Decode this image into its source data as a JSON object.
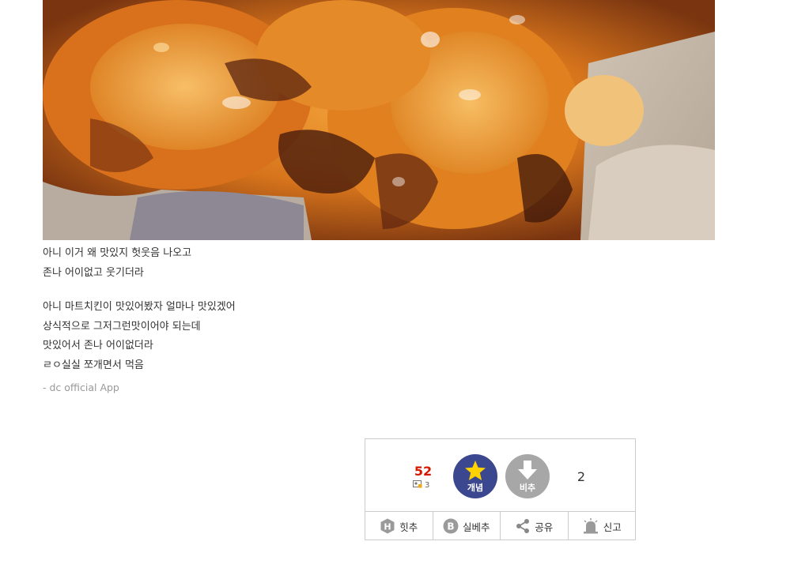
{
  "post": {
    "lines_1": [
      "아니 이거 왜 맛있지 헛웃음 나오고",
      "존나 어이없고 웃기더라"
    ],
    "lines_2": [
      "아니 마트치킨이 맛있어봤자 얼마나 맛있겠어",
      "상식적으로 그저그런맛이어야 되는데",
      "맛있어서 존나 어이없더라",
      "ㄹㅇ실실 쪼개면서 먹음"
    ],
    "signature": "- dc official App"
  },
  "vote": {
    "up_count": "52",
    "fixed_count": "3",
    "up_label": "개념",
    "down_label": "비추",
    "down_count": "2",
    "up_color": "#3b4890",
    "down_color": "#a7a7a7",
    "count_color": "#d31900",
    "star_color": "#ffd200"
  },
  "actions": [
    {
      "label": "힛추",
      "icon": "hit-icon"
    },
    {
      "label": "실베추",
      "icon": "best-icon"
    },
    {
      "label": "공유",
      "icon": "share-icon"
    },
    {
      "label": "신고",
      "icon": "siren-icon"
    }
  ]
}
